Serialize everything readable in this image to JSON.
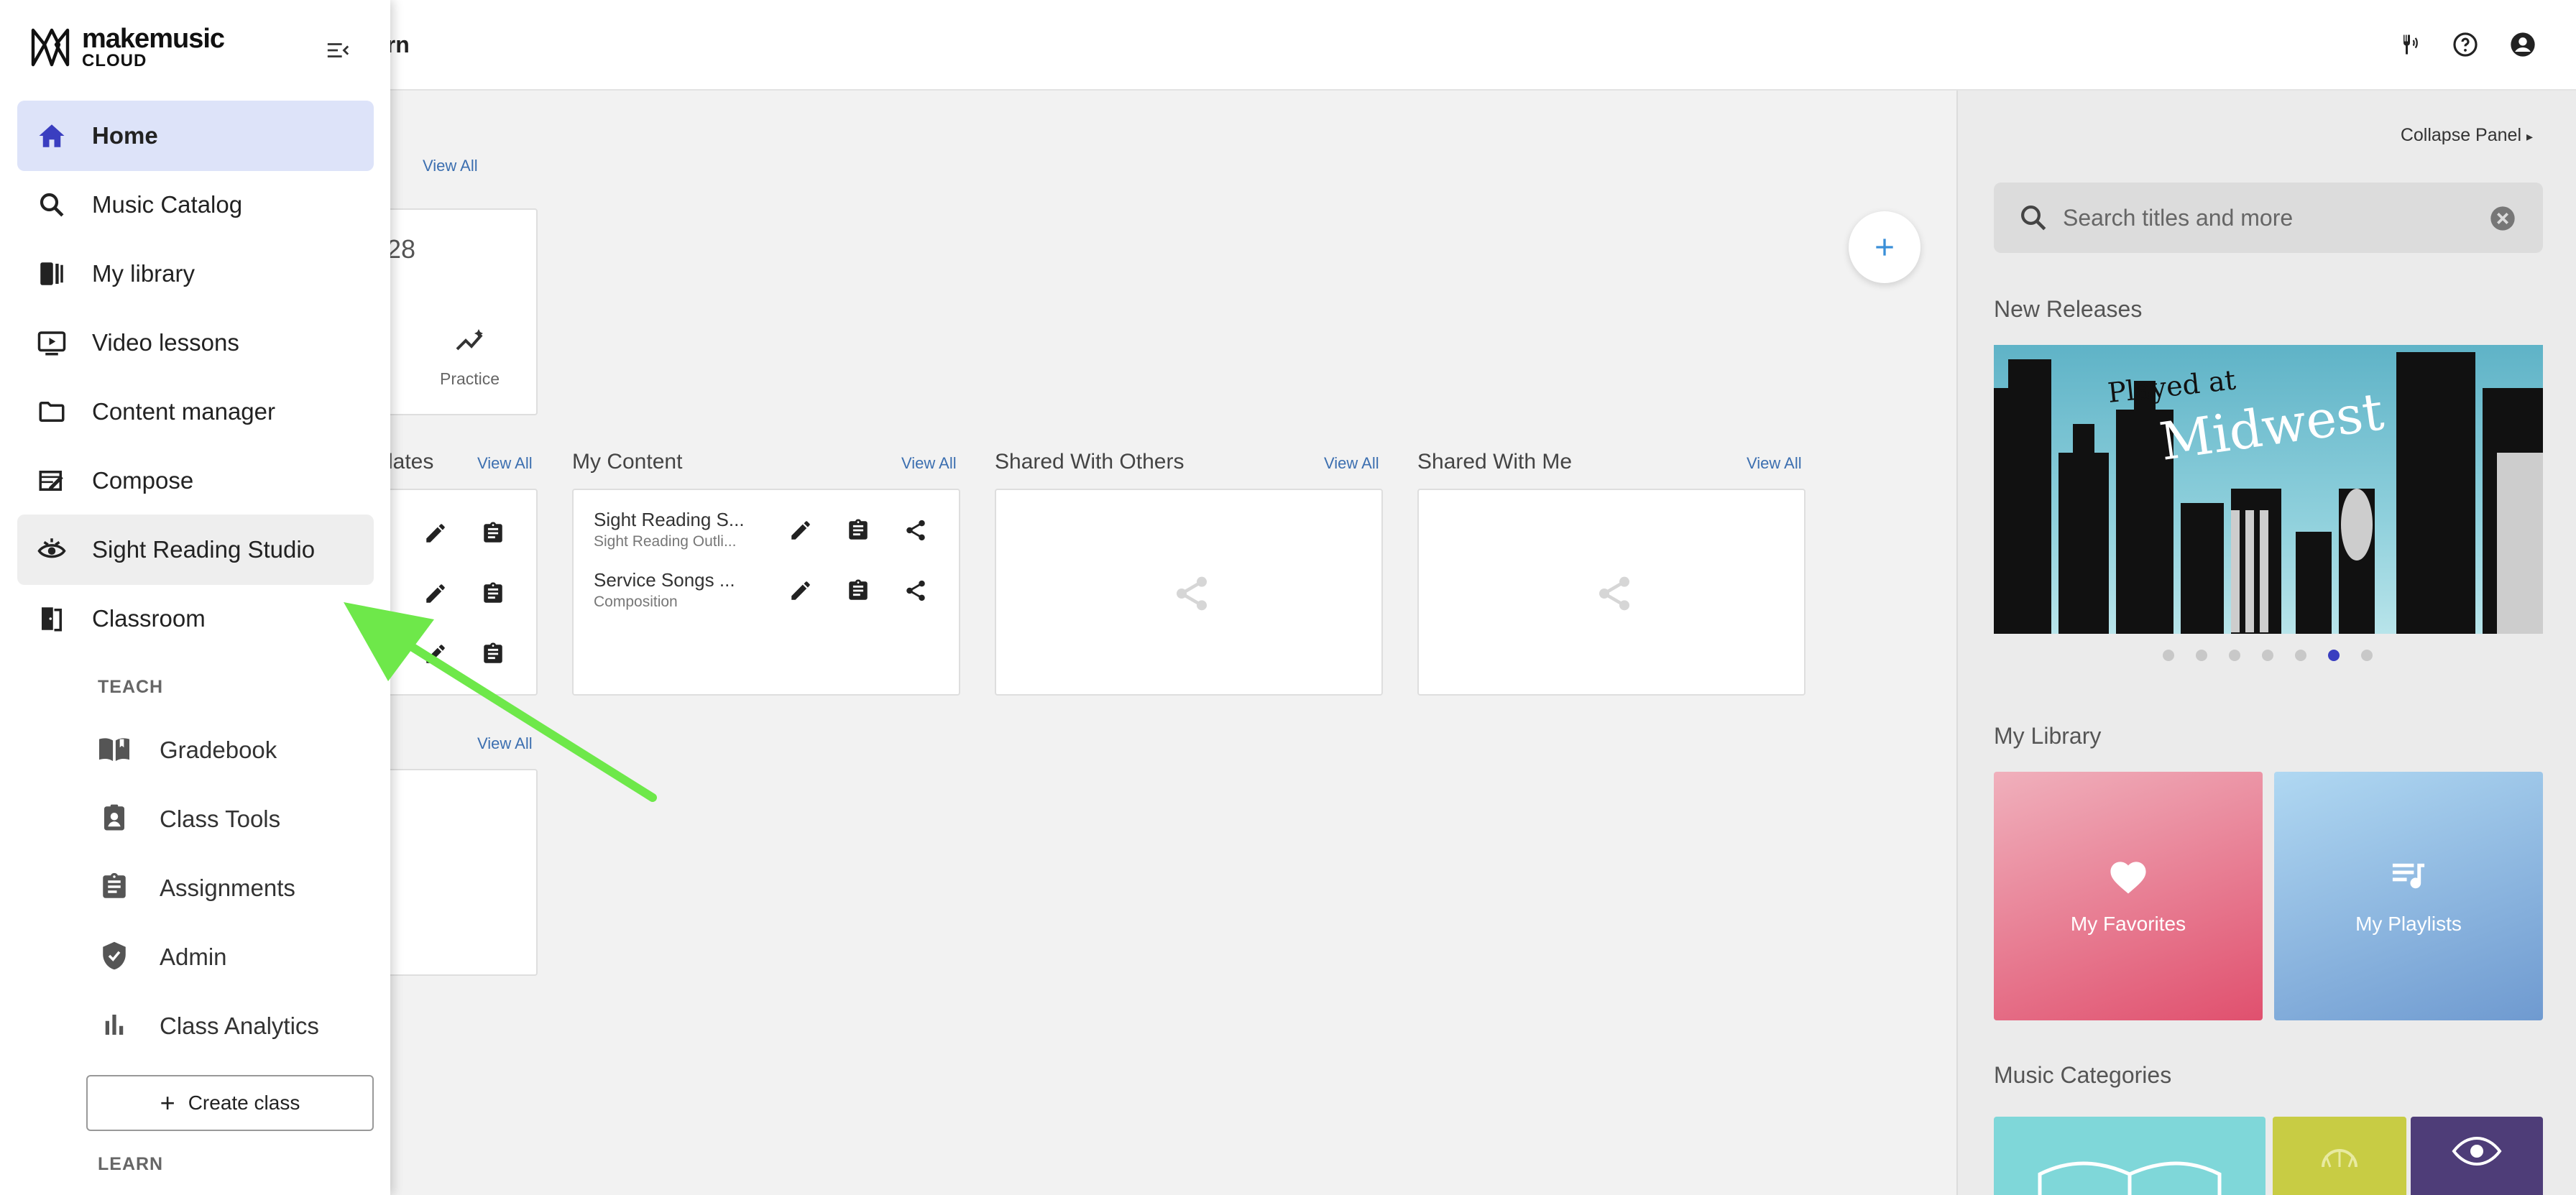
{
  "topbar": {
    "title": "arn"
  },
  "main": {
    "view_all": "View All",
    "top_card": {
      "number": "28",
      "action_label": "Practice"
    },
    "templates_partial": "lates",
    "sections": {
      "my_content": "My Content",
      "shared_with_others": "Shared With Others",
      "shared_with_me": "Shared With Me"
    },
    "my_content_items": [
      {
        "title": "Sight Reading S...",
        "subtitle": "Sight Reading Outli..."
      },
      {
        "title": "Service Songs ...",
        "subtitle": "Composition"
      }
    ]
  },
  "right_panel": {
    "collapse_label": "Collapse Panel",
    "search_placeholder": "Search titles and more",
    "new_releases": "New Releases",
    "banner": {
      "line1": "Played at",
      "line2": "Midwest"
    },
    "carousel": {
      "count": 7,
      "active": 6
    },
    "my_library": "My Library",
    "favorites": "My Favorites",
    "playlists": "My Playlists",
    "music_categories": "Music Categories"
  },
  "drawer": {
    "logo_line1": "makemusic",
    "logo_line2": "CLOUD",
    "nav": [
      {
        "label": "Home",
        "icon": "home-icon"
      },
      {
        "label": "Music Catalog",
        "icon": "search-icon"
      },
      {
        "label": "My library",
        "icon": "library-icon"
      },
      {
        "label": "Video lessons",
        "icon": "video-icon"
      },
      {
        "label": "Content manager",
        "icon": "folder-icon"
      },
      {
        "label": "Compose",
        "icon": "compose-icon"
      },
      {
        "label": "Sight Reading Studio",
        "icon": "eye-icon"
      },
      {
        "label": "Classroom",
        "icon": "classroom-icon"
      }
    ],
    "teach_heading": "TEACH",
    "teach_items": [
      {
        "label": "Gradebook",
        "icon": "gradebook-icon"
      },
      {
        "label": "Class Tools",
        "icon": "class-tools-icon"
      },
      {
        "label": "Assignments",
        "icon": "assignments-icon"
      },
      {
        "label": "Admin",
        "icon": "shield-icon"
      },
      {
        "label": "Class Analytics",
        "icon": "analytics-icon"
      }
    ],
    "create_class": "Create class",
    "learn_heading": "LEARN"
  },
  "colors": {
    "accent": "#3a3ec0",
    "active_bg": "#dde3f9",
    "arrow": "#6ee84a"
  }
}
